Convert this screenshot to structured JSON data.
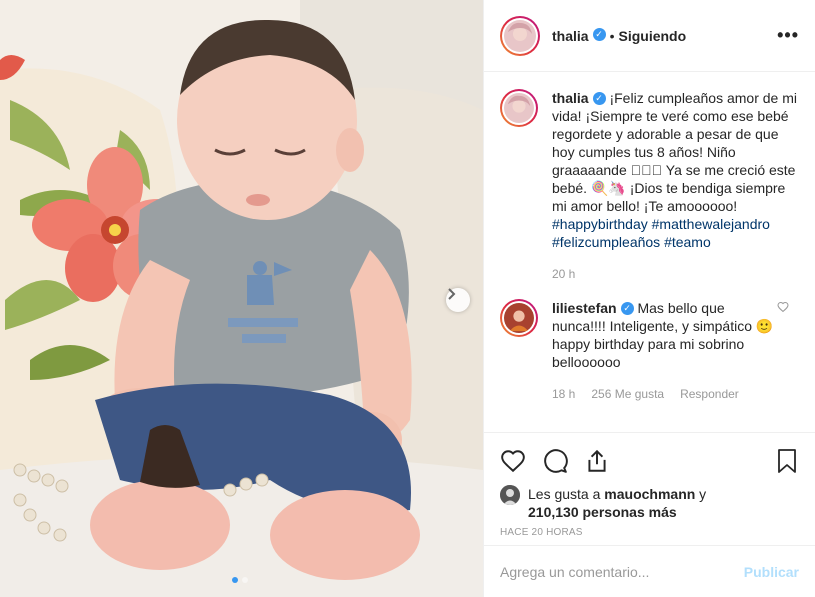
{
  "post": {
    "author": "thalia",
    "follow_sep": "•",
    "follow_label": "Siguiendo",
    "more_label": "•••",
    "next_icon": "chevron-right-icon"
  },
  "caption": {
    "author": "thalia",
    "text_1": "¡Feliz cumpleaños amor de mi vida! ¡Siempre te veré como ese bebé regordete y adorable a pesar de que hoy cumples tus 8 años! Niño graaaaande ",
    "emoji_1": "🏼🏼🏼",
    "text_2": " Ya se me creció este bebé. ",
    "emoji_2": "🍭🦄",
    "text_3": " ¡Dios te bendiga siempre mi amor bello! ¡Te amoooooo! ",
    "hashtags": [
      "#happybirthday",
      "#matthewalejandro",
      "#felizcumpleaños",
      "#teamo"
    ],
    "time": "20 h"
  },
  "reply": {
    "author": "liliestefan",
    "text_1": "Mas bello que nunca!!!! Inteligente, y simpático ",
    "emoji": "🙂",
    "text_2": "happy birthday para mi sobrino belloooooo",
    "time": "18 h",
    "likes": "256 Me gusta",
    "reply_label": "Responder"
  },
  "likes": {
    "prefix": "Les gusta a ",
    "first_user": "mauochmann",
    "middle": " y ",
    "count": "210,130 personas más"
  },
  "timestamp": "HACE 20 HORAS",
  "composer": {
    "placeholder": "Agrega un comentario...",
    "publish_label": "Publicar"
  },
  "colors": {
    "accent": "#3897f0",
    "hashtag": "#003569",
    "muted": "#999999",
    "publish_disabled": "#b2dffc"
  }
}
